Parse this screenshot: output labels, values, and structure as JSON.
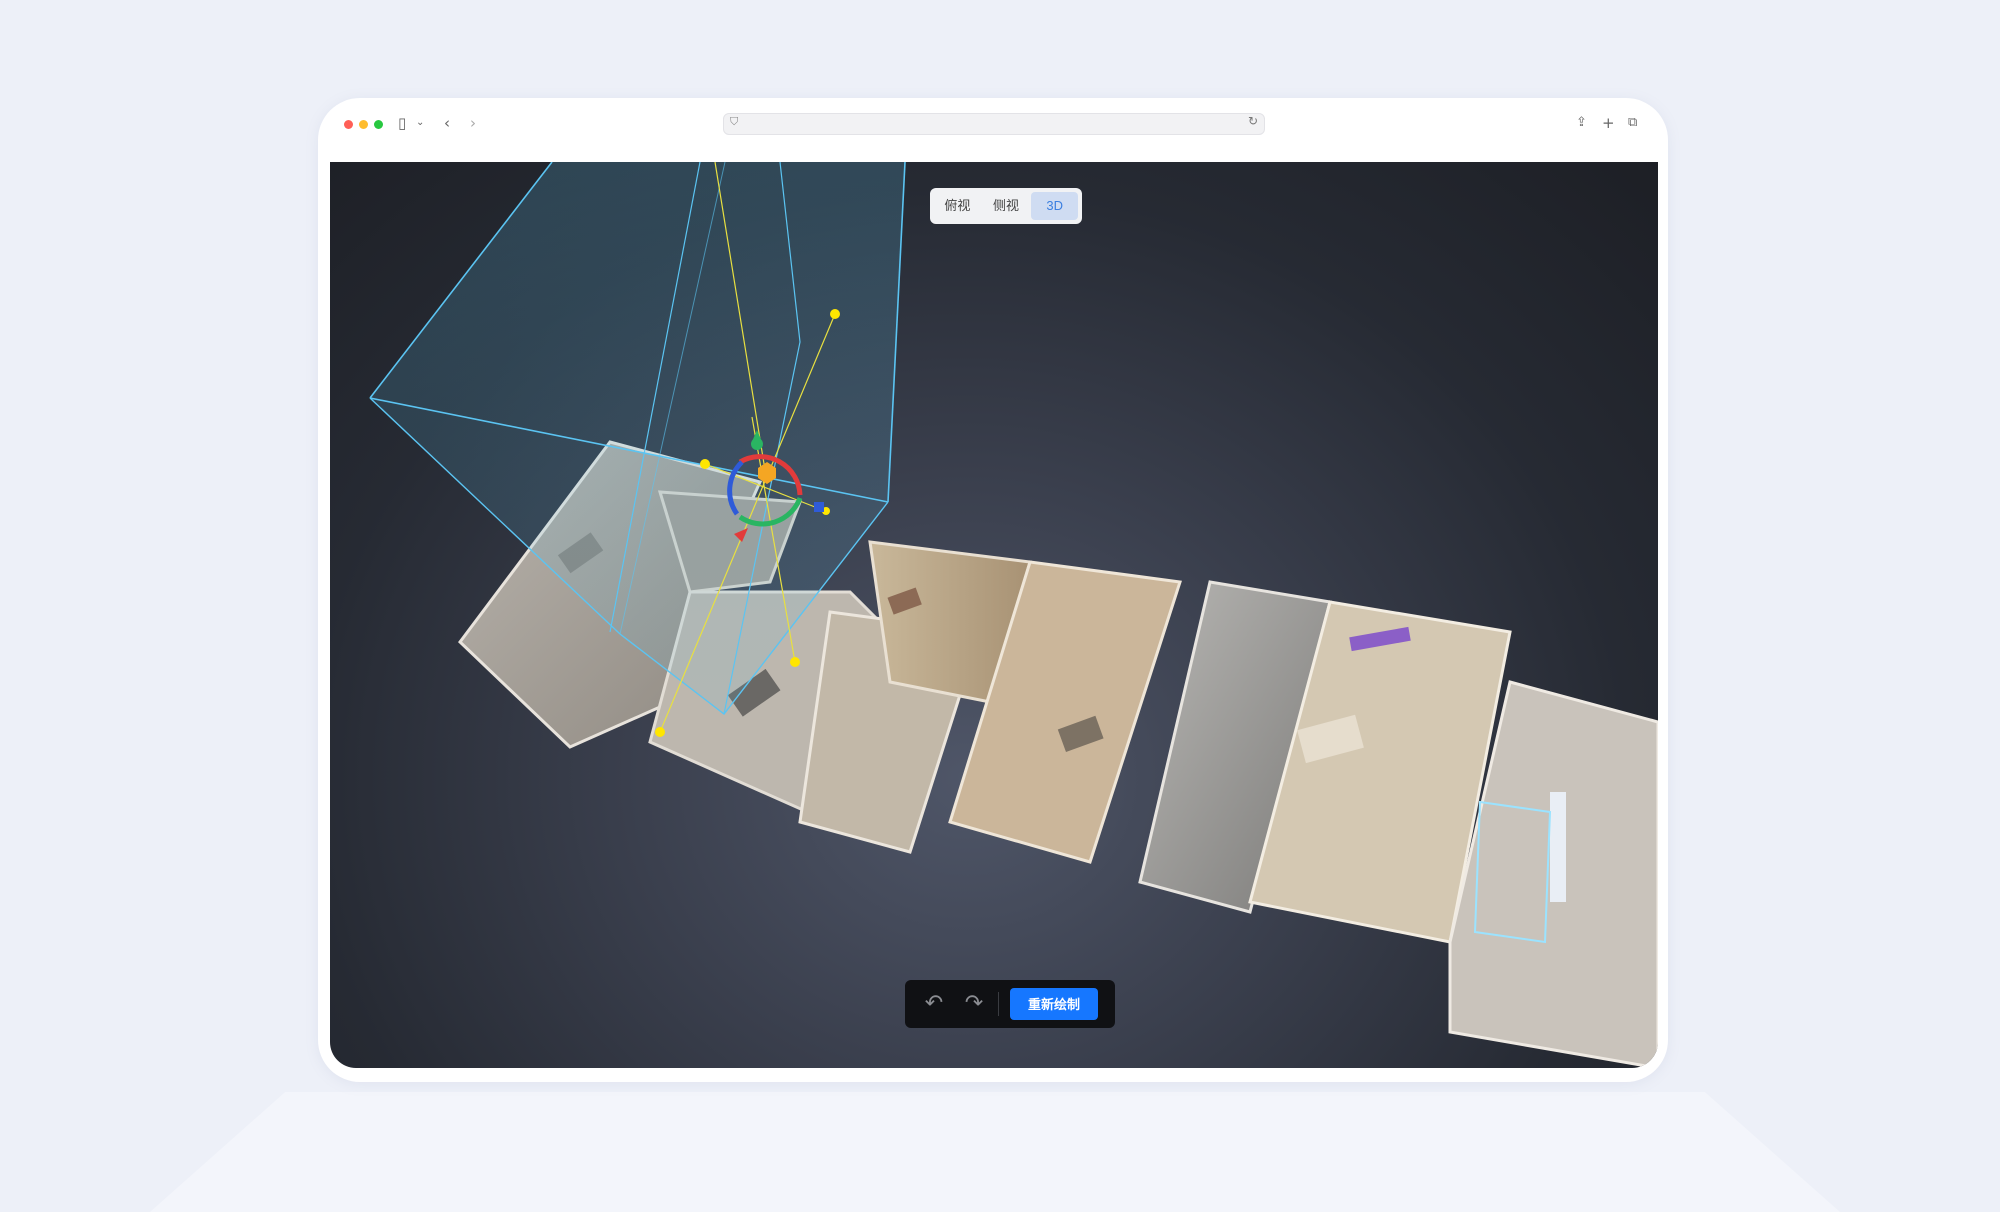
{
  "window": {
    "traffic_lights": [
      "#ff5f57",
      "#febc2e",
      "#28c840"
    ],
    "icons": {
      "sidebar": "sidebar-icon",
      "back": "chevron-left-icon",
      "forward": "chevron-right-icon",
      "share": "share-icon",
      "new_tab": "plus-icon",
      "tabs": "tabs-overview-icon",
      "privacy": "shield-icon",
      "reload": "reload-icon"
    }
  },
  "view_toggle": {
    "options": [
      {
        "label": "俯视",
        "active": false
      },
      {
        "label": "侧视",
        "active": false
      },
      {
        "label": "3D",
        "active": true
      }
    ]
  },
  "bottom_toolbar": {
    "undo_icon": "undo-icon",
    "redo_icon": "redo-icon",
    "redraw_label": "重新绘制"
  },
  "colors": {
    "accent": "#1677ff",
    "active_tab_text": "#3b7fe0",
    "bounding_box": "#5bc4f2",
    "handle": "#ffe600"
  }
}
